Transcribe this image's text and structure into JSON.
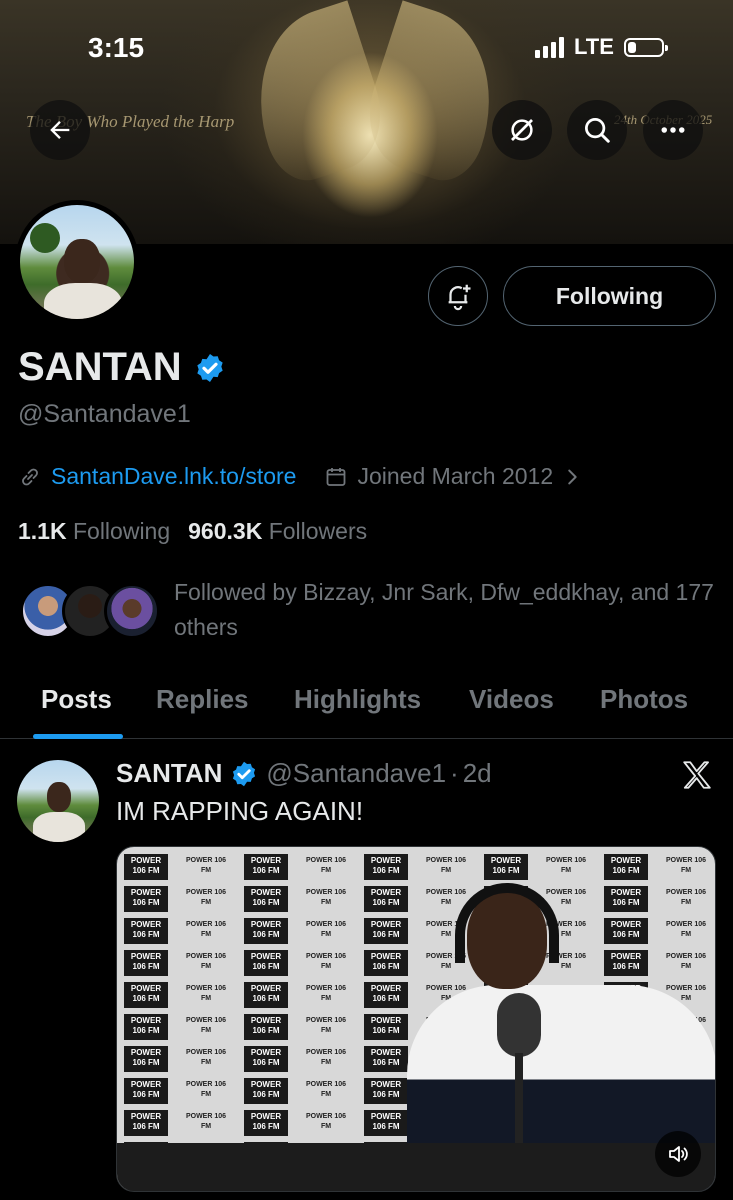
{
  "status_bar": {
    "time": "3:15",
    "network": "LTE",
    "battery_level": 0.25
  },
  "banner": {
    "title_text": "The Boy Who Played the Harp",
    "date_text": "24th October 2025"
  },
  "header": {
    "icons": [
      "back-arrow-icon",
      "grok-icon",
      "search-icon",
      "more-icon"
    ]
  },
  "profile": {
    "display_name": "SANTAN",
    "verified": true,
    "handle": "@Santandave1",
    "link": "SantanDave.lnk.to/store",
    "joined": "Joined March 2012",
    "following_count": "1.1K",
    "following_label": "Following",
    "followers_count": "960.3K",
    "followers_label": "Followers",
    "followed_by": "Followed by Bizzay, Jnr Sark, Dfw_eddkhay, and 177 others",
    "follow_button_label": "Following"
  },
  "tabs": [
    {
      "label": "Posts",
      "active": true
    },
    {
      "label": "Replies",
      "active": false
    },
    {
      "label": "Highlights",
      "active": false
    },
    {
      "label": "Videos",
      "active": false
    },
    {
      "label": "Photos",
      "active": false
    }
  ],
  "post": {
    "name": "SANTAN",
    "handle": "@Santandave1",
    "separator": "·",
    "time": "2d",
    "text": "IM RAPPING AGAIN!",
    "video_logo_text": "POWER 106 FM"
  },
  "colors": {
    "accent": "#1d9bf0",
    "muted": "#71767b",
    "background": "#000000",
    "text": "#e7e9ea"
  }
}
